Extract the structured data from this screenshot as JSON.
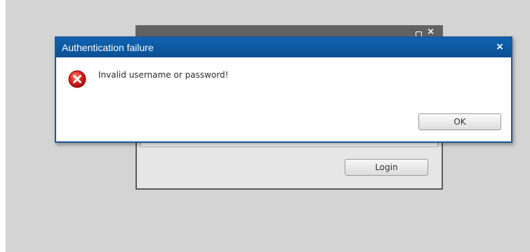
{
  "background_window": {
    "login_button_label": "Login",
    "controls": {
      "maximize_icon": "maximize-icon",
      "close_icon": "close-icon",
      "close_glyph": "×"
    }
  },
  "dialog": {
    "title": "Authentication failure",
    "close_glyph": "×",
    "icon": "error-icon",
    "message": "Invalid username or password!",
    "ok_label": "OK"
  },
  "colors": {
    "dialog_titlebar": "#0f63b1",
    "background_titlebar": "#626262",
    "desktop": "#d4d4d4",
    "error_red": "#e0201b"
  }
}
